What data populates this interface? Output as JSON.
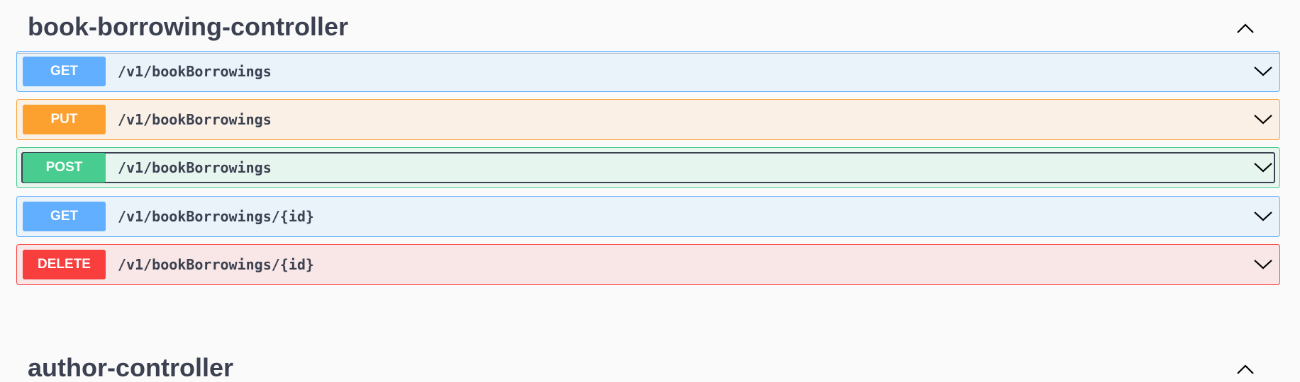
{
  "sections": [
    {
      "title": "book-borrowing-controller",
      "toggle_icon": "chevron-up-icon",
      "operations": [
        {
          "method": "GET",
          "path": "/v1/bookBorrowings",
          "toggle_icon": "chevron-down-icon"
        },
        {
          "method": "PUT",
          "path": "/v1/bookBorrowings",
          "toggle_icon": "chevron-down-icon"
        },
        {
          "method": "POST",
          "path": "/v1/bookBorrowings",
          "toggle_icon": "chevron-down-icon",
          "focused": true
        },
        {
          "method": "GET",
          "path": "/v1/bookBorrowings/{id}",
          "toggle_icon": "chevron-down-icon"
        },
        {
          "method": "DELETE",
          "path": "/v1/bookBorrowings/{id}",
          "toggle_icon": "chevron-down-icon"
        }
      ]
    },
    {
      "title": "author-controller",
      "toggle_icon": "chevron-up-icon"
    }
  ],
  "colors": {
    "get": "#61affe",
    "put": "#fca130",
    "post": "#49cc90",
    "delete": "#f93e3e",
    "text": "#3b4151",
    "background": "#fafafa"
  }
}
